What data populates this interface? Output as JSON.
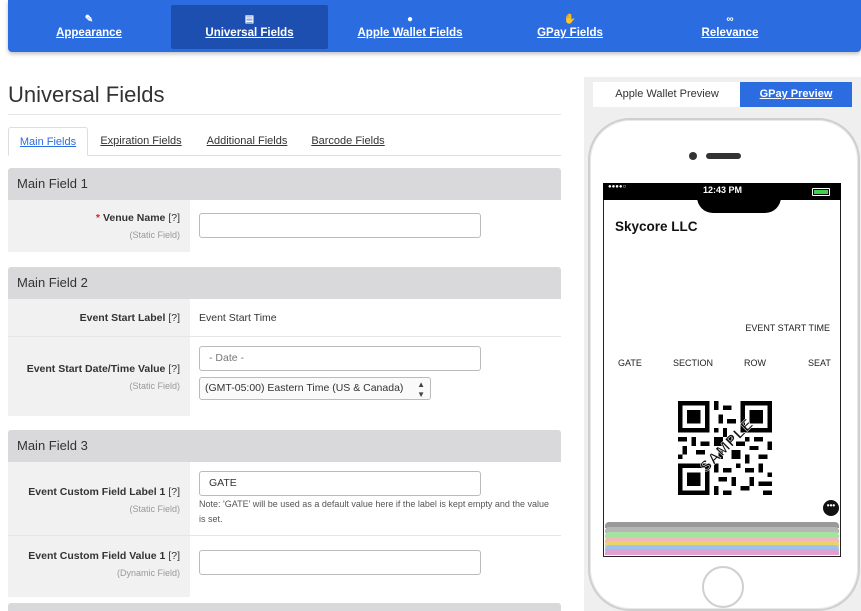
{
  "nav": [
    {
      "label": "Appearance",
      "icon": "magic-wand-icon",
      "glyph": "✎",
      "active": false
    },
    {
      "label": "Universal Fields",
      "icon": "file-icon",
      "glyph": "▤",
      "active": true
    },
    {
      "label": "Apple Wallet Fields",
      "icon": "apple-icon",
      "glyph": "●",
      "active": false
    },
    {
      "label": "GPay Fields",
      "icon": "hand-icon",
      "glyph": "✋",
      "active": false
    },
    {
      "label": "Relevance",
      "icon": "link-icon",
      "glyph": "∞",
      "active": false
    }
  ],
  "page_title": "Universal Fields",
  "tabs": [
    {
      "label": "Main Fields",
      "active": true
    },
    {
      "label": "Expiration Fields",
      "active": false
    },
    {
      "label": "Additional Fields",
      "active": false
    },
    {
      "label": "Barcode Fields",
      "active": false
    }
  ],
  "sections": {
    "s1": {
      "title": "Main Field 1",
      "venue_label": "Venue Name",
      "required_mark": "*",
      "help": "[?]",
      "venue_type": "(Static Field)",
      "venue_value": ""
    },
    "s2": {
      "title": "Main Field 2",
      "start_label_label": "Event Start Label",
      "start_label_value": "Event Start Time",
      "start_dt_label": "Event Start Date/Time Value",
      "start_dt_type": "(Static Field)",
      "date_placeholder": "- Date -",
      "timezone": "(GMT-05:00) Eastern Time (US & Canada)"
    },
    "s3": {
      "title": "Main Field 3",
      "custom_label_label": "Event Custom Field Label 1",
      "custom_label_type": "(Static Field)",
      "custom_label_value": "GATE",
      "note": "Note: 'GATE' will be used as a default value here if the label is kept empty and the value is set.",
      "custom_value_label": "Event Custom Field Value 1",
      "custom_value_type": "(Dynamic Field)",
      "custom_value_value": ""
    }
  },
  "preview": {
    "tabs": {
      "apple": "Apple Wallet Preview",
      "gpay": "GPay Preview"
    },
    "status_time": "12:43 PM",
    "signal_dots": "●●●●○",
    "company": "Skycore LLC",
    "event_start": "EVENT START TIME",
    "fields": [
      "GATE",
      "SECTION",
      "ROW",
      "SEAT"
    ],
    "watermark": "SAMPLE",
    "more_glyph": "•••",
    "colors": {
      "accent": "#2b6de0",
      "battery": "#3fd14a",
      "stack": [
        "#9a9a9a",
        "#b7b7b7",
        "#a6e3a1",
        "#f2b8b8",
        "#e9d36b",
        "#9cc3ee",
        "#e0a0d0"
      ]
    }
  }
}
